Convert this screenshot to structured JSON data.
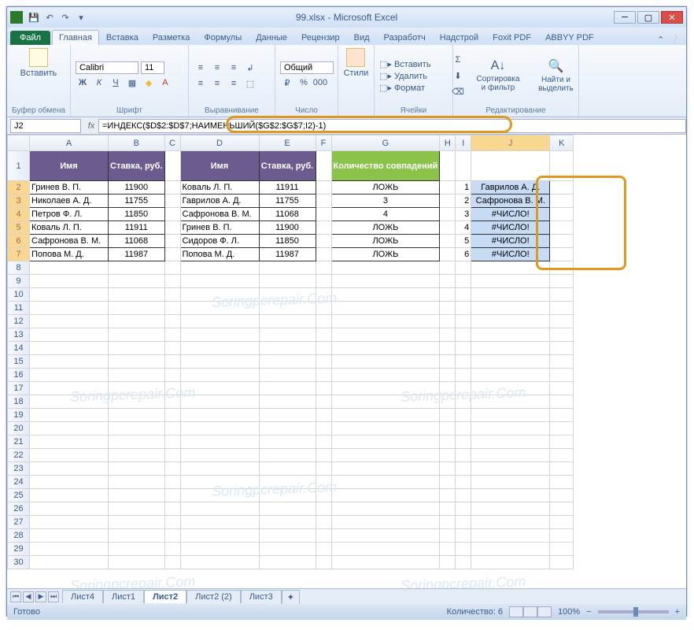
{
  "window": {
    "title": "99.xlsx - Microsoft Excel"
  },
  "tabs": {
    "file": "Файл",
    "items": [
      "Главная",
      "Вставка",
      "Разметка",
      "Формулы",
      "Данные",
      "Рецензир",
      "Вид",
      "Разработч",
      "Надстрой",
      "Foxit PDF",
      "ABBYY PDF"
    ],
    "active": 0
  },
  "ribbon": {
    "clipboard": {
      "paste": "Вставить",
      "name": "Буфер обмена"
    },
    "font": {
      "family": "Calibri",
      "size": "11",
      "name": "Шрифт"
    },
    "align": {
      "name": "Выравнивание"
    },
    "number": {
      "format": "Общий",
      "name": "Число"
    },
    "styles": {
      "btn": "Стили"
    },
    "cells": {
      "insert": "Вставить",
      "delete": "Удалить",
      "format": "Формат",
      "name": "Ячейки"
    },
    "editing": {
      "sort": "Сортировка и фильтр",
      "find": "Найти и выделить",
      "name": "Редактирование"
    }
  },
  "formula": {
    "cell": "J2",
    "value": "=ИНДЕКС($D$2:$D$7;НАИМЕНЬШИЙ($G$2:$G$7;I2)-1)"
  },
  "cols": [
    "A",
    "B",
    "C",
    "D",
    "E",
    "F",
    "G",
    "H",
    "I",
    "J",
    "K"
  ],
  "widths": [
    100,
    60,
    20,
    100,
    72,
    20,
    82,
    20,
    20,
    100,
    30
  ],
  "headers": {
    "A": "Имя",
    "B": "Ставка, руб.",
    "D": "Имя",
    "E": "Ставка, руб.",
    "G": "Количество совпадений"
  },
  "data": {
    "r2": {
      "A": "Гринев В. П.",
      "B": "11900",
      "D": "Коваль Л. П.",
      "E": "11911",
      "G": "ЛОЖЬ",
      "I": "1",
      "J": "Гаврилов А. Д."
    },
    "r3": {
      "A": "Николаев А. Д.",
      "B": "11755",
      "D": "Гаврилов А. Д.",
      "E": "11755",
      "G": "3",
      "I": "2",
      "J": "Сафронова В. М."
    },
    "r4": {
      "A": "Петров Ф. Л.",
      "B": "11850",
      "D": "Сафронова В. М.",
      "E": "11068",
      "G": "4",
      "I": "3",
      "J": "#ЧИСЛО!"
    },
    "r5": {
      "A": "Коваль Л. П.",
      "B": "11911",
      "D": "Гринев В. П.",
      "E": "11900",
      "G": "ЛОЖЬ",
      "I": "4",
      "J": "#ЧИСЛО!"
    },
    "r6": {
      "A": "Сафронова В. М.",
      "B": "11068",
      "D": "Сидоров Ф. Л.",
      "E": "11850",
      "G": "ЛОЖЬ",
      "I": "5",
      "J": "#ЧИСЛО!"
    },
    "r7": {
      "A": "Попова М. Д.",
      "B": "11987",
      "D": "Попова М. Д.",
      "E": "11987",
      "G": "ЛОЖЬ",
      "I": "6",
      "J": "#ЧИСЛО!"
    }
  },
  "sheets": {
    "items": [
      "Лист4",
      "Лист1",
      "Лист2",
      "Лист2 (2)",
      "Лист3"
    ],
    "active": 2
  },
  "status": {
    "ready": "Готово",
    "count": "Количество: 6",
    "zoom": "100%"
  },
  "watermark": "Soringpcrepair.Com"
}
